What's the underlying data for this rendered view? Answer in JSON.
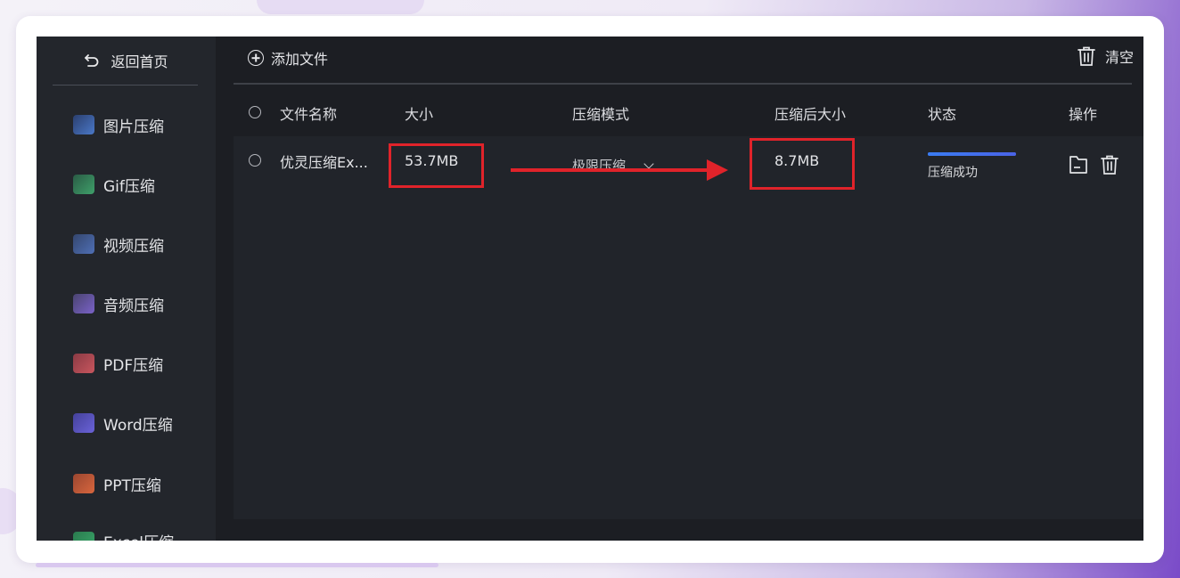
{
  "sidebar": {
    "home_label": "返回首页",
    "items": [
      {
        "label": "图片压缩",
        "icon": "image-compress-icon",
        "color": "#4a78c8"
      },
      {
        "label": "Gif压缩",
        "icon": "gif-compress-icon",
        "color": "#3fa06a"
      },
      {
        "label": "视频压缩",
        "icon": "video-compress-icon",
        "color": "#4f6fb5"
      },
      {
        "label": "音频压缩",
        "icon": "audio-compress-icon",
        "color": "#7a62c8"
      },
      {
        "label": "PDF压缩",
        "icon": "pdf-compress-icon",
        "color": "#c8565e"
      },
      {
        "label": "Word压缩",
        "icon": "word-compress-icon",
        "color": "#6a62d8"
      },
      {
        "label": "PPT压缩",
        "icon": "ppt-compress-icon",
        "color": "#d8663e"
      },
      {
        "label": "Excel压缩",
        "icon": "excel-compress-icon",
        "color": "#3aa86a"
      }
    ]
  },
  "toolbar": {
    "add_label": "添加文件",
    "clear_label": "清空"
  },
  "table": {
    "headers": {
      "name": "文件名称",
      "size": "大小",
      "mode": "压缩模式",
      "compressed_size": "压缩后大小",
      "status": "状态",
      "actions": "操作"
    },
    "rows": [
      {
        "name": "优灵压缩Ex...",
        "size": "53.7MB",
        "mode": "极限压缩",
        "compressed_size": "8.7MB",
        "status": "压缩成功",
        "progress": 1.0
      }
    ]
  },
  "colors": {
    "highlight": "#e0232a",
    "progress": "#3a6fe8",
    "app_bg": "#1c1e23"
  }
}
